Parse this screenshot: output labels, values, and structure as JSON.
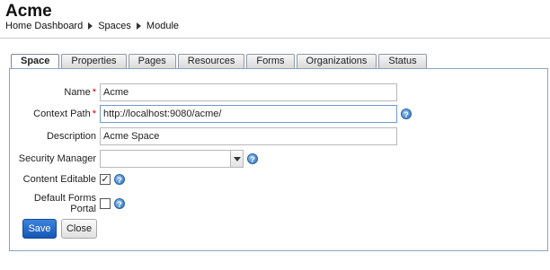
{
  "header": {
    "title": "Acme",
    "breadcrumbs": [
      "Home Dashboard",
      "Spaces",
      "Module"
    ]
  },
  "tabs": [
    {
      "label": "Space",
      "active": true
    },
    {
      "label": "Properties",
      "active": false
    },
    {
      "label": "Pages",
      "active": false
    },
    {
      "label": "Resources",
      "active": false
    },
    {
      "label": "Forms",
      "active": false
    },
    {
      "label": "Organizations",
      "active": false
    },
    {
      "label": "Status",
      "active": false
    }
  ],
  "form": {
    "name": {
      "label": "Name",
      "required_mark": "*",
      "value": "Acme"
    },
    "context_path": {
      "label": "Context Path",
      "required_mark": "*",
      "value": "http://localhost:9080/acme/"
    },
    "description": {
      "label": "Description",
      "value": "Acme Space"
    },
    "security_manager": {
      "label": "Security Manager",
      "value": ""
    },
    "content_editable": {
      "label": "Content Editable",
      "checked": true,
      "check_glyph": "✓"
    },
    "default_forms_portal": {
      "label": "Default Forms Portal",
      "checked": false
    }
  },
  "help_glyph": "?",
  "buttons": {
    "save": "Save",
    "close": "Close"
  },
  "colors": {
    "primary_button": "#1f66c7",
    "panel_border": "#8aa3c0",
    "required": "#cc0000",
    "help_icon": "#2f6fb8"
  }
}
